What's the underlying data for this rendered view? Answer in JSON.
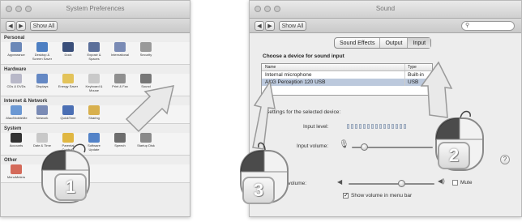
{
  "left_window": {
    "title": "System Preferences",
    "show_all_label": "Show All",
    "sections": [
      {
        "title": "Personal",
        "panes": [
          {
            "label": "Appearance",
            "color": "#6b88b8"
          },
          {
            "label": "Desktop & Screen Saver",
            "color": "#4d7fc2"
          },
          {
            "label": "Dock",
            "color": "#3a4f7a"
          },
          {
            "label": "Exposé & Spaces",
            "color": "#5b6f9a"
          },
          {
            "label": "International",
            "color": "#7a8bb5"
          },
          {
            "label": "Security",
            "color": "#9a9a9a"
          }
        ]
      },
      {
        "title": "Hardware",
        "panes": [
          {
            "label": "CDs & DVDs",
            "color": "#b8b8c8"
          },
          {
            "label": "Displays",
            "color": "#6488c4"
          },
          {
            "label": "Energy Saver",
            "color": "#e3c35a"
          },
          {
            "label": "Keyboard & Mouse",
            "color": "#c9c9c9"
          },
          {
            "label": "Print & Fax",
            "color": "#8f8f8f"
          },
          {
            "label": "Sound",
            "color": "#777777"
          }
        ]
      },
      {
        "title": "Internet & Network",
        "panes": [
          {
            "label": ".Mac/MobileMe",
            "color": "#6b98d3"
          },
          {
            "label": "Network",
            "color": "#7a8bb5"
          },
          {
            "label": "QuickTime",
            "color": "#4b6fb4"
          },
          {
            "label": "Sharing",
            "color": "#d8b04e"
          }
        ]
      },
      {
        "title": "System",
        "panes": [
          {
            "label": "Accounts",
            "color": "#333333"
          },
          {
            "label": "Date & Time",
            "color": "#c8c8c8"
          },
          {
            "label": "Parental Controls",
            "color": "#e0b742"
          },
          {
            "label": "Software Update",
            "color": "#5383c8"
          },
          {
            "label": "Speech",
            "color": "#6d6d6d"
          },
          {
            "label": "Startup Disk",
            "color": "#8a8a8a"
          }
        ]
      },
      {
        "title": "Other",
        "panes": [
          {
            "label": "MenuMeters",
            "color": "#d46a5a"
          }
        ]
      }
    ]
  },
  "right_window": {
    "title": "Sound",
    "show_all_label": "Show All",
    "search_placeholder": "",
    "tabs": [
      "Sound Effects",
      "Output",
      "Input"
    ],
    "active_tab": "Input",
    "choose_label": "Choose a device for sound input",
    "columns": [
      "Name",
      "Type"
    ],
    "devices": [
      {
        "name": "Internal microphone",
        "type": "Built-in"
      },
      {
        "name": "AKG Perception 120 USB",
        "type": "USB"
      }
    ],
    "selected_device": "AKG Perception 120 USB",
    "settings_label": "Settings for the selected device:",
    "input_level_label": "Input level:",
    "input_volume_label": "Input volume:",
    "input_volume": 0.15,
    "output_volume_label": "Output volume:",
    "output_volume": 0.62,
    "mute_label": "Mute",
    "show_volume_label": "Show volume in menu bar",
    "show_volume_checked": true
  },
  "steps": [
    "1",
    "2",
    "3"
  ]
}
